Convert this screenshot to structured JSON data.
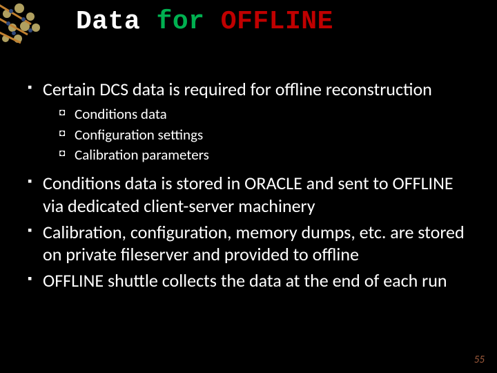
{
  "title": {
    "word1": "Data",
    "word2": "for",
    "word3": "OFFLINE"
  },
  "bullets": [
    {
      "text": "Certain DCS data is required for offline reconstruction",
      "sub": [
        "Conditions data",
        "Configuration settings",
        "Calibration parameters"
      ]
    },
    {
      "text": "Conditions data is stored in ORACLE and sent to OFFLINE via dedicated client-server machinery",
      "sub": []
    },
    {
      "text": "Calibration, configuration, memory dumps, etc. are stored on private fileserver and provided to offline",
      "sub": []
    },
    {
      "text": "OFFLINE shuttle collects the data at the end of each run",
      "sub": []
    }
  ],
  "page_number": "55"
}
